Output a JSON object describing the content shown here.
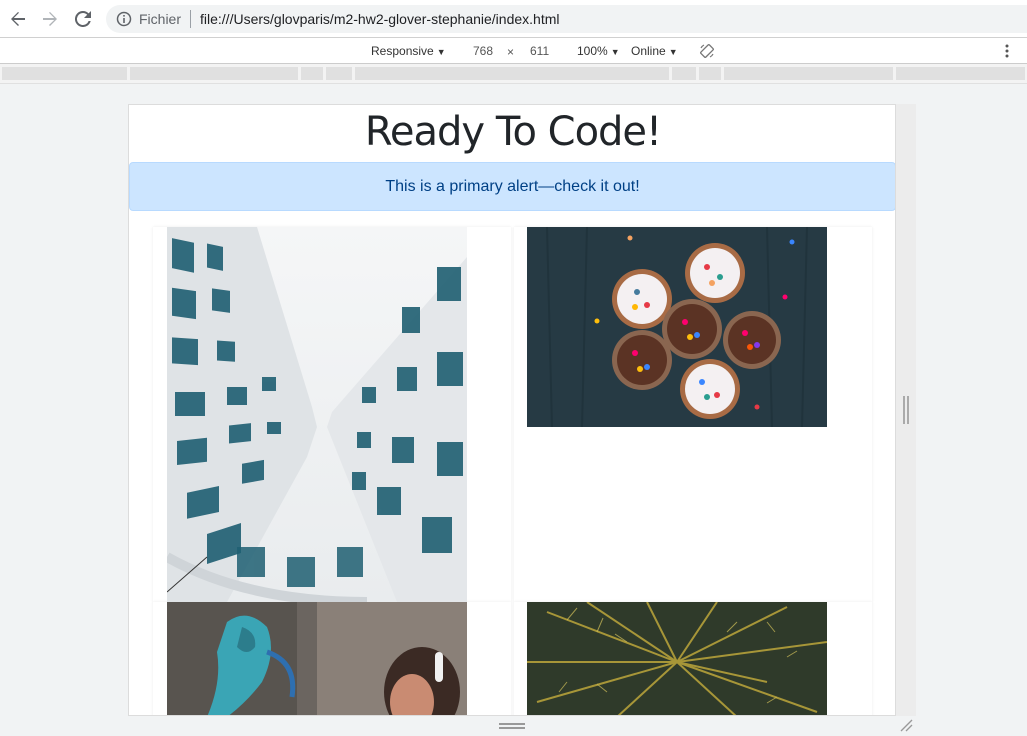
{
  "browser": {
    "back_icon": "arrow-left-icon",
    "forward_icon": "arrow-right-icon",
    "reload_icon": "reload-icon",
    "info_icon": "info-circle-icon",
    "scheme_label": "Fichier",
    "url": "file:///Users/glovparis/m2-hw2-glover-stephanie/index.html"
  },
  "device_toolbar": {
    "device": "Responsive",
    "width": "768",
    "times": "×",
    "height": "611",
    "zoom": "100%",
    "network": "Online",
    "caret": "▼",
    "rotate_icon": "rotate-icon",
    "more_icon": "kebab-menu-icon"
  },
  "page": {
    "title": "Ready To Code!",
    "alert_text": "This is a primary alert—check it out!",
    "alert_bg": "#cce5ff",
    "alert_color": "#004085",
    "images": [
      {
        "subject": "building",
        "icon": "building-photo"
      },
      {
        "subject": "cupcakes",
        "icon": "cupcakes-photo"
      },
      {
        "subject": "graffiti",
        "icon": "graffiti-photo"
      },
      {
        "subject": "palm",
        "icon": "palm-photo"
      }
    ]
  }
}
